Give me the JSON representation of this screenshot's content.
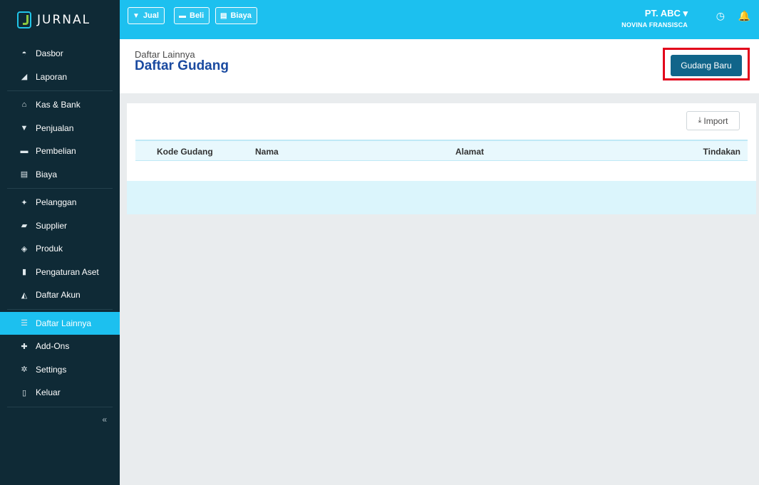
{
  "app": {
    "logo_text": "JURNAL"
  },
  "sidebar": {
    "groups": [
      [
        {
          "icon": "dashboard-icon",
          "glyph": "◓",
          "label": "Dasbor"
        },
        {
          "icon": "chart-icon",
          "glyph": "◢",
          "label": "Laporan"
        }
      ],
      [
        {
          "icon": "bank-icon",
          "glyph": "⌂",
          "label": "Kas & Bank"
        },
        {
          "icon": "tag-icon",
          "glyph": "▼",
          "label": "Penjualan"
        },
        {
          "icon": "card-icon",
          "glyph": "▬",
          "label": "Pembelian"
        },
        {
          "icon": "receipt-icon",
          "glyph": "▤",
          "label": "Biaya"
        }
      ],
      [
        {
          "icon": "users-icon",
          "glyph": "✦",
          "label": "Pelanggan"
        },
        {
          "icon": "truck-icon",
          "glyph": "▰",
          "label": "Supplier"
        },
        {
          "icon": "box-icon",
          "glyph": "◈",
          "label": "Produk"
        },
        {
          "icon": "asset-icon",
          "glyph": "▮",
          "label": "Pengaturan Aset"
        },
        {
          "icon": "book-icon",
          "glyph": "◭",
          "label": "Daftar Akun"
        }
      ],
      [
        {
          "icon": "list-icon",
          "glyph": "☰",
          "label": "Daftar Lainnya",
          "active": true
        },
        {
          "icon": "puzzle-icon",
          "glyph": "✚",
          "label": "Add-Ons"
        },
        {
          "icon": "gear-icon",
          "glyph": "✲",
          "label": "Settings"
        },
        {
          "icon": "door-icon",
          "glyph": "▯",
          "label": "Keluar"
        }
      ]
    ],
    "collapse_label": "«"
  },
  "topbar": {
    "quick_buttons": [
      {
        "icon": "tag-icon",
        "glyph": "▼",
        "label": "Jual"
      },
      {
        "icon": "card-icon",
        "glyph": "▬",
        "label": "Beli"
      },
      {
        "icon": "receipt-icon",
        "glyph": "▤",
        "label": "Biaya"
      }
    ],
    "company_name": "PT. ABC ▾",
    "user_name": "NOVINA FRANSISCA",
    "clock_glyph": "◷",
    "bell_glyph": "🔔"
  },
  "header": {
    "breadcrumb": "Daftar Lainnya",
    "title": "Daftar Gudang",
    "new_button_label": "Gudang Baru"
  },
  "panel": {
    "import_glyph": "⤓",
    "import_label": "Import",
    "columns": [
      "Kode Gudang",
      "Nama",
      "Alamat",
      "Tindakan"
    ]
  },
  "colors": {
    "sidebar": "#0f2a36",
    "accent": "#1cc0ef",
    "primary_button": "#11658a",
    "highlight": "#e2001a"
  }
}
